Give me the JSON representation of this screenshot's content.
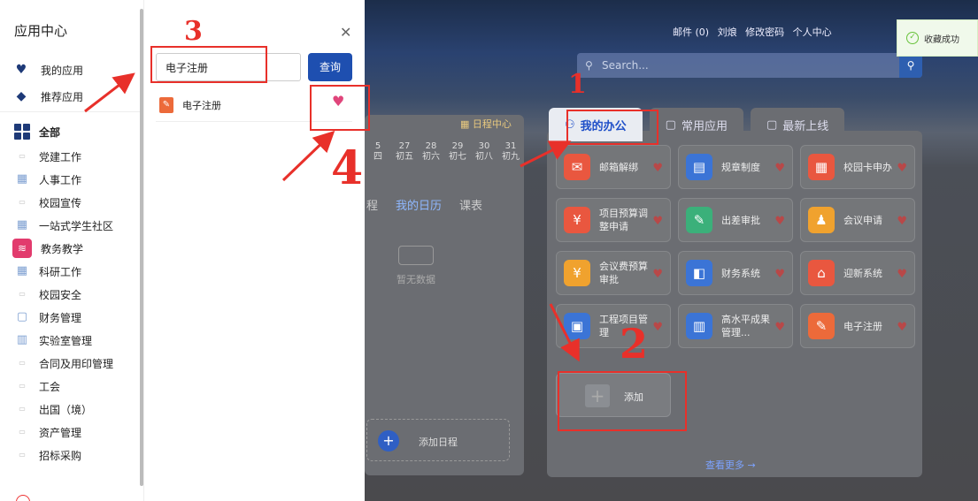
{
  "sidebar": {
    "title": "应用中心",
    "top_items": [
      {
        "label": "我的应用",
        "icon": "heart-icon"
      },
      {
        "label": "推荐应用",
        "icon": "layers-icon"
      }
    ],
    "categories": [
      {
        "label": "全部",
        "icon": "grid-icon",
        "style": "all"
      },
      {
        "label": "党建工作",
        "icon": "placeholder-icon"
      },
      {
        "label": "人事工作",
        "icon": "building-icon"
      },
      {
        "label": "校园宣传",
        "icon": "placeholder-icon"
      },
      {
        "label": "一站式学生社区",
        "icon": "building-icon"
      },
      {
        "label": "教务教学",
        "icon": "stack-icon"
      },
      {
        "label": "科研工作",
        "icon": "building-icon"
      },
      {
        "label": "校园安全",
        "icon": "placeholder-icon"
      },
      {
        "label": "财务管理",
        "icon": "monitor-icon"
      },
      {
        "label": "实验室管理",
        "icon": "map-icon"
      },
      {
        "label": "合同及用印管理",
        "icon": "placeholder-icon"
      },
      {
        "label": "工会",
        "icon": "placeholder-icon"
      },
      {
        "label": "出国（境）",
        "icon": "placeholder-icon"
      },
      {
        "label": "资产管理",
        "icon": "placeholder-icon"
      },
      {
        "label": "招标采购",
        "icon": "placeholder-icon"
      }
    ]
  },
  "drawer": {
    "search_value": "电子注册",
    "search_button": "查询",
    "result": {
      "name": "电子注册",
      "favorited": true
    }
  },
  "portal": {
    "topbar": {
      "mail": "邮件 (0)",
      "user": "刘烺",
      "change_password": "修改密码",
      "personal_center": "个人中心"
    },
    "search_placeholder": "Search...",
    "calendar": {
      "header_link": "日程中心",
      "days": [
        {
          "date": "5",
          "lunar": "四"
        },
        {
          "date": "27",
          "lunar": "初五"
        },
        {
          "date": "28",
          "lunar": "初六"
        },
        {
          "date": "29",
          "lunar": "初七"
        },
        {
          "date": "30",
          "lunar": "初八"
        },
        {
          "date": "31",
          "lunar": "初九"
        }
      ],
      "tabs": [
        "程",
        "我的日历",
        "课表"
      ],
      "empty_text": "暂无数据",
      "add_label": "添加日程"
    },
    "tabs": [
      {
        "label": "我的办公",
        "active": true
      },
      {
        "label": "常用应用",
        "active": false
      },
      {
        "label": "最新上线",
        "active": false
      }
    ],
    "apps": [
      {
        "name": "邮箱解绑",
        "color": "#e9573f",
        "glyph": "✉"
      },
      {
        "name": "规章制度",
        "color": "#3b74d6",
        "glyph": "▤"
      },
      {
        "name": "校园卡申办",
        "color": "#e9573f",
        "glyph": "▦"
      },
      {
        "name": "项目预算调整申请",
        "color": "#e9573f",
        "glyph": "¥"
      },
      {
        "name": "出差审批",
        "color": "#3bb07a",
        "glyph": "✎"
      },
      {
        "name": "会议申请",
        "color": "#f0a22e",
        "glyph": "♟"
      },
      {
        "name": "会议费预算审批",
        "color": "#f0a22e",
        "glyph": "¥"
      },
      {
        "name": "财务系统",
        "color": "#3b74d6",
        "glyph": "◧"
      },
      {
        "name": "迎新系统",
        "color": "#e9573f",
        "glyph": "⌂"
      },
      {
        "name": "工程项目管理",
        "color": "#3b74d6",
        "glyph": "▣"
      },
      {
        "name": "高水平成果管理...",
        "color": "#3b74d6",
        "glyph": "▥"
      },
      {
        "name": "电子注册",
        "color": "#ec6a3a",
        "glyph": "✎"
      }
    ],
    "add_label": "添加",
    "more_label": "查看更多 →"
  },
  "toast": {
    "text": "收藏成功"
  },
  "annotations": [
    "1",
    "2",
    "3",
    "4"
  ],
  "colors": {
    "accent": "#1e4fb0",
    "annotation": "#e8302a",
    "heart": "#e0457b"
  }
}
